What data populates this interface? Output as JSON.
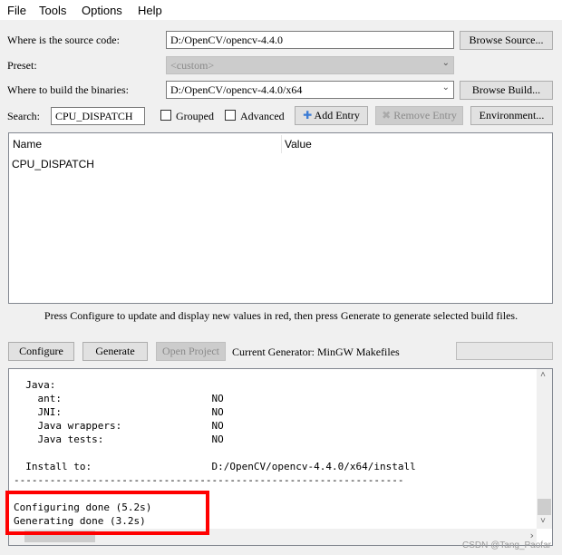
{
  "menu": [
    "File",
    "Tools",
    "Options",
    "Help"
  ],
  "source": {
    "label": "Where is the source code:",
    "value": "D:/OpenCV/opencv-4.4.0",
    "button": "Browse Source..."
  },
  "preset": {
    "label": "Preset:",
    "value": "<custom>"
  },
  "build": {
    "label": "Where to build the binaries:",
    "value": "D:/OpenCV/opencv-4.4.0/x64",
    "button": "Browse Build..."
  },
  "search": {
    "label": "Search:",
    "value": "CPU_DISPATCH"
  },
  "grouped": {
    "label": "Grouped",
    "checked": false
  },
  "advanced": {
    "label": "Advanced",
    "checked": false
  },
  "add_entry": "Add Entry",
  "remove_entry": "Remove Entry",
  "environment": "Environment...",
  "table": {
    "columns": [
      "Name",
      "Value"
    ],
    "rows": [
      [
        "CPU_DISPATCH",
        ""
      ]
    ]
  },
  "hint": "Press Configure to update and display new values in red, then press Generate to generate selected build files.",
  "configure": "Configure",
  "generate": "Generate",
  "open_project": "Open Project",
  "generator": "Current Generator: MinGW Makefiles",
  "output": "  Java:\n    ant:                         NO\n    JNI:                         NO\n    Java wrappers:               NO\n    Java tests:                  NO\n\n  Install to:                    D:/OpenCV/opencv-4.4.0/x64/install\n-----------------------------------------------------------------\n\nConfiguring done (5.2s)\nGenerating done (3.2s)",
  "watermark": "CSDN @Tang_Paofar",
  "colors": {
    "highlight": "#ff0000",
    "add_icon": "#3a7bd5"
  }
}
